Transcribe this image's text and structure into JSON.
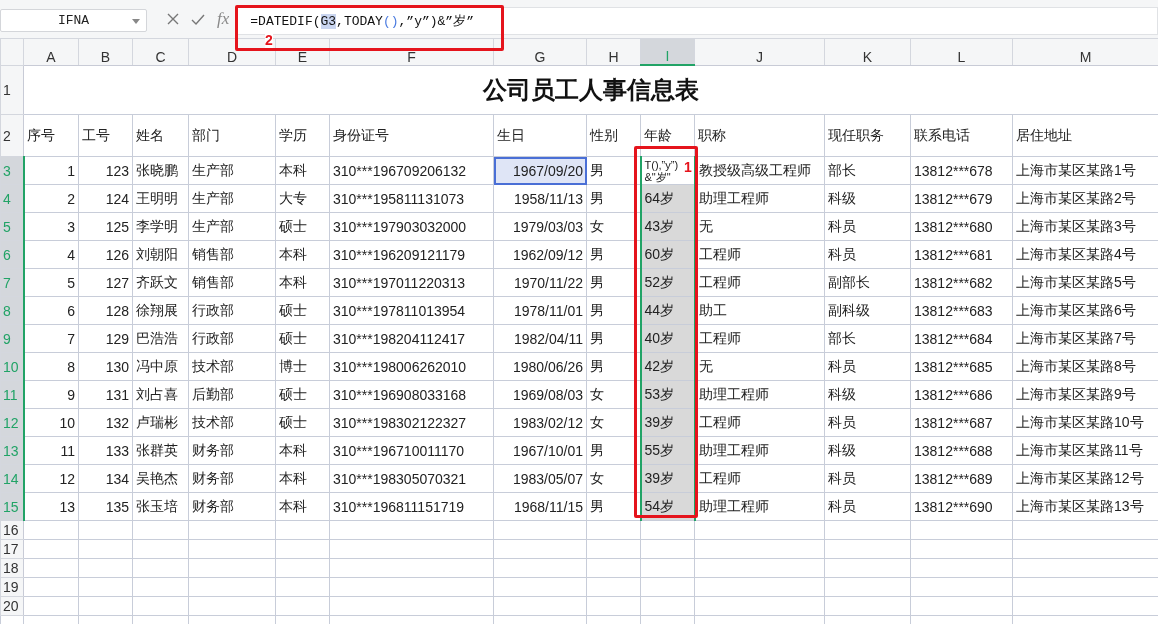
{
  "name_box": "IFNA",
  "function_label": "fx",
  "formula": [
    {
      "text": "=DATEDIF(",
      "kind": "plain"
    },
    {
      "text": "G3",
      "kind": "ref"
    },
    {
      "text": ",TODAY",
      "kind": "plain"
    },
    {
      "text": "()",
      "kind": "paren"
    },
    {
      "text": ",”y”)&”岁”",
      "kind": "plain"
    }
  ],
  "column_headers": [
    {
      "label": "A",
      "selected": false
    },
    {
      "label": "B",
      "selected": false
    },
    {
      "label": "C",
      "selected": false
    },
    {
      "label": "D",
      "selected": false
    },
    {
      "label": "E",
      "selected": false
    },
    {
      "label": "F",
      "selected": false
    },
    {
      "label": "G",
      "selected": false
    },
    {
      "label": "H",
      "selected": false
    },
    {
      "label": "I",
      "selected": true
    },
    {
      "label": "J",
      "selected": false
    },
    {
      "label": "K",
      "selected": false
    },
    {
      "label": "L",
      "selected": false
    },
    {
      "label": "M",
      "selected": false
    }
  ],
  "title": {
    "number": "1",
    "text": "公司员工人事信息表"
  },
  "header_row": {
    "number": "2",
    "cells": [
      "序号",
      "工号",
      "姓名",
      "部门",
      "学历",
      "身份证号",
      "生日",
      "性别",
      "年龄",
      "职称",
      "现任职务",
      "联系电话",
      "居住地址"
    ]
  },
  "rows": [
    {
      "number": "3",
      "selected": true,
      "cells": [
        {
          "text": "1"
        },
        {
          "text": "123"
        },
        {
          "text": "张晓鹏"
        },
        {
          "text": "生产部"
        },
        {
          "text": "本科"
        },
        {
          "text": "310***196709206132"
        },
        {
          "text": "1967/09/20",
          "referenced": true
        },
        {
          "text": "男"
        },
        {
          "text": "T(),”y”)\n&\"岁\"",
          "editing": true
        },
        {
          "text": "教授级高级工程师"
        },
        {
          "text": "部长"
        },
        {
          "text": "13812***678"
        },
        {
          "text": "上海市某区某路1号"
        }
      ]
    },
    {
      "number": "4",
      "selected": true,
      "cells": [
        {
          "text": "2"
        },
        {
          "text": "124"
        },
        {
          "text": "王明明"
        },
        {
          "text": "生产部"
        },
        {
          "text": "大专"
        },
        {
          "text": "310***195811131073"
        },
        {
          "text": "1958/11/13"
        },
        {
          "text": "男"
        },
        {
          "text": "64岁"
        },
        {
          "text": "助理工程师"
        },
        {
          "text": "科级"
        },
        {
          "text": "13812***679"
        },
        {
          "text": "上海市某区某路2号"
        }
      ]
    },
    {
      "number": "5",
      "selected": true,
      "cells": [
        {
          "text": "3"
        },
        {
          "text": "125"
        },
        {
          "text": "李学明"
        },
        {
          "text": "生产部"
        },
        {
          "text": "硕士"
        },
        {
          "text": "310***197903032000"
        },
        {
          "text": "1979/03/03"
        },
        {
          "text": "女"
        },
        {
          "text": "43岁"
        },
        {
          "text": "无"
        },
        {
          "text": "科员"
        },
        {
          "text": "13812***680"
        },
        {
          "text": "上海市某区某路3号"
        }
      ]
    },
    {
      "number": "6",
      "selected": true,
      "cells": [
        {
          "text": "4"
        },
        {
          "text": "126"
        },
        {
          "text": "刘朝阳"
        },
        {
          "text": "销售部"
        },
        {
          "text": "本科"
        },
        {
          "text": "310***196209121179"
        },
        {
          "text": "1962/09/12"
        },
        {
          "text": "男"
        },
        {
          "text": "60岁"
        },
        {
          "text": "工程师"
        },
        {
          "text": "科员"
        },
        {
          "text": "13812***681"
        },
        {
          "text": "上海市某区某路4号"
        }
      ]
    },
    {
      "number": "7",
      "selected": true,
      "cells": [
        {
          "text": "5"
        },
        {
          "text": "127"
        },
        {
          "text": "齐跃文"
        },
        {
          "text": "销售部"
        },
        {
          "text": "本科"
        },
        {
          "text": "310***197011220313"
        },
        {
          "text": "1970/11/22"
        },
        {
          "text": "男"
        },
        {
          "text": "52岁"
        },
        {
          "text": "工程师"
        },
        {
          "text": "副部长"
        },
        {
          "text": "13812***682"
        },
        {
          "text": "上海市某区某路5号"
        }
      ]
    },
    {
      "number": "8",
      "selected": true,
      "cells": [
        {
          "text": "6"
        },
        {
          "text": "128"
        },
        {
          "text": "徐翔展"
        },
        {
          "text": "行政部"
        },
        {
          "text": "硕士"
        },
        {
          "text": "310***197811013954"
        },
        {
          "text": "1978/11/01"
        },
        {
          "text": "男"
        },
        {
          "text": "44岁"
        },
        {
          "text": "助工"
        },
        {
          "text": "副科级"
        },
        {
          "text": "13812***683"
        },
        {
          "text": "上海市某区某路6号"
        }
      ]
    },
    {
      "number": "9",
      "selected": true,
      "cells": [
        {
          "text": "7"
        },
        {
          "text": "129"
        },
        {
          "text": "巴浩浩"
        },
        {
          "text": "行政部"
        },
        {
          "text": "硕士"
        },
        {
          "text": "310***198204112417"
        },
        {
          "text": "1982/04/11"
        },
        {
          "text": "男"
        },
        {
          "text": "40岁"
        },
        {
          "text": "工程师"
        },
        {
          "text": "部长"
        },
        {
          "text": "13812***684"
        },
        {
          "text": "上海市某区某路7号"
        }
      ]
    },
    {
      "number": "10",
      "selected": true,
      "cells": [
        {
          "text": "8"
        },
        {
          "text": "130"
        },
        {
          "text": "冯中原"
        },
        {
          "text": "技术部"
        },
        {
          "text": "博士"
        },
        {
          "text": "310***198006262010"
        },
        {
          "text": "1980/06/26"
        },
        {
          "text": "男"
        },
        {
          "text": "42岁"
        },
        {
          "text": "无"
        },
        {
          "text": "科员"
        },
        {
          "text": "13812***685"
        },
        {
          "text": "上海市某区某路8号"
        }
      ]
    },
    {
      "number": "11",
      "selected": true,
      "cells": [
        {
          "text": "9"
        },
        {
          "text": "131"
        },
        {
          "text": "刘占喜"
        },
        {
          "text": "后勤部"
        },
        {
          "text": "硕士"
        },
        {
          "text": "310***196908033168"
        },
        {
          "text": "1969/08/03"
        },
        {
          "text": "女"
        },
        {
          "text": "53岁"
        },
        {
          "text": "助理工程师"
        },
        {
          "text": "科级"
        },
        {
          "text": "13812***686"
        },
        {
          "text": "上海市某区某路9号"
        }
      ]
    },
    {
      "number": "12",
      "selected": true,
      "cells": [
        {
          "text": "10"
        },
        {
          "text": "132"
        },
        {
          "text": "卢瑞彬"
        },
        {
          "text": "技术部"
        },
        {
          "text": "硕士"
        },
        {
          "text": "310***198302122327"
        },
        {
          "text": "1983/02/12"
        },
        {
          "text": "女"
        },
        {
          "text": "39岁"
        },
        {
          "text": "工程师"
        },
        {
          "text": "科员"
        },
        {
          "text": "13812***687"
        },
        {
          "text": "上海市某区某路10号"
        }
      ]
    },
    {
      "number": "13",
      "selected": true,
      "cells": [
        {
          "text": "11"
        },
        {
          "text": "133"
        },
        {
          "text": "张群英"
        },
        {
          "text": "财务部"
        },
        {
          "text": "本科"
        },
        {
          "text": "310***196710011170"
        },
        {
          "text": "1967/10/01"
        },
        {
          "text": "男"
        },
        {
          "text": "55岁"
        },
        {
          "text": "助理工程师"
        },
        {
          "text": "科级"
        },
        {
          "text": "13812***688"
        },
        {
          "text": "上海市某区某路11号"
        }
      ]
    },
    {
      "number": "14",
      "selected": true,
      "cells": [
        {
          "text": "12"
        },
        {
          "text": "134"
        },
        {
          "text": "吴艳杰"
        },
        {
          "text": "财务部"
        },
        {
          "text": "本科"
        },
        {
          "text": "310***198305070321"
        },
        {
          "text": "1983/05/07"
        },
        {
          "text": "女"
        },
        {
          "text": "39岁"
        },
        {
          "text": "工程师"
        },
        {
          "text": "科员"
        },
        {
          "text": "13812***689"
        },
        {
          "text": "上海市某区某路12号"
        }
      ]
    },
    {
      "number": "15",
      "selected": true,
      "cells": [
        {
          "text": "13"
        },
        {
          "text": "135"
        },
        {
          "text": "张玉培"
        },
        {
          "text": "财务部"
        },
        {
          "text": "本科"
        },
        {
          "text": "310***196811151719"
        },
        {
          "text": "1968/11/15"
        },
        {
          "text": "男"
        },
        {
          "text": "54岁"
        },
        {
          "text": "助理工程师"
        },
        {
          "text": "科员"
        },
        {
          "text": "13812***690"
        },
        {
          "text": "上海市某区某路13号"
        }
      ]
    }
  ],
  "empty_rows": [
    {
      "number": "16",
      "selected": false
    },
    {
      "number": "17",
      "selected": false
    },
    {
      "number": "18",
      "selected": false
    },
    {
      "number": "19",
      "selected": false
    },
    {
      "number": "20",
      "selected": false
    }
  ],
  "annotations": [
    {
      "label": "2",
      "kind": "formula"
    },
    {
      "label": "1",
      "kind": "column"
    }
  ]
}
